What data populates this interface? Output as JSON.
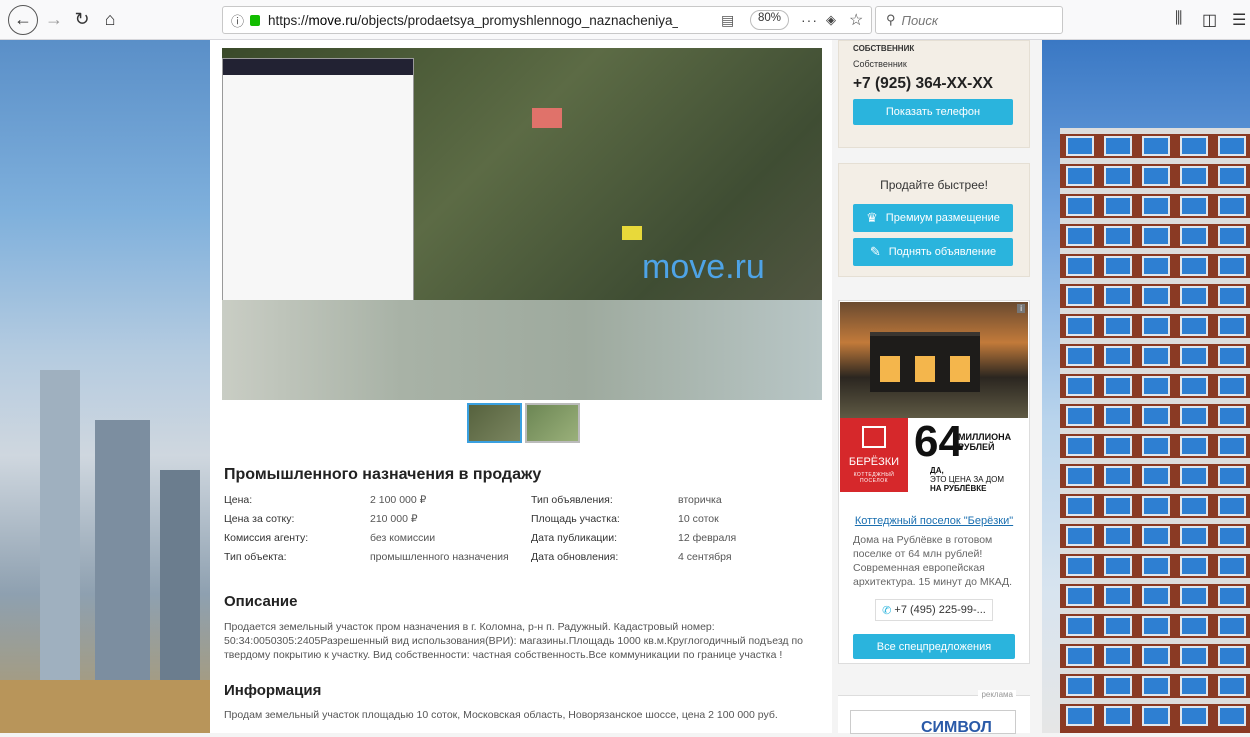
{
  "browser": {
    "url_prefix": "https://",
    "url_host": "move.ru",
    "url_path": "/objects/prodaetsya_promyshlennogo_naznacheniya_ploschad",
    "zoom": "80%",
    "search_placeholder": "Поиск"
  },
  "listing": {
    "watermark": "move.ru",
    "title": "Промышленного назначения в продажу",
    "props": [
      {
        "k1": "Цена:",
        "v1": "2 100 000 ₽",
        "k2": "Тип объявления:",
        "v2": "вторичка"
      },
      {
        "k1": "Цена за сотку:",
        "v1": "210 000 ₽",
        "k2": "Площадь участка:",
        "v2": "10 соток"
      },
      {
        "k1": "Комиссия агенту:",
        "v1": "без комиссии",
        "k2": "Дата публикации:",
        "v2": "12 февраля"
      },
      {
        "k1": "Тип объекта:",
        "v1": "промышленного назначения",
        "k2": "Дата обновления:",
        "v2": "4 сентября"
      }
    ],
    "description_heading": "Описание",
    "description": "Продается земельный участок пром назначения в г. Коломна, р-н п. Радужный. Кадастровый номер: 50:34:0050305:2405Разрешенный вид использования(ВРИ): магазины.Площадь 1000 кв.м.Круглогодичный подъезд по твердому покрытию к участку. Вид собственности: частная собственность.Все коммуникации по границе участка !",
    "info_heading": "Информация",
    "info": "Продам земельный участок площадью 10 соток, Московская область, Новорязанское шоссе, цена 2 100 000 руб."
  },
  "sidebar": {
    "owner_cut": "СОБСТВЕННИК",
    "owner_role": "Собственник",
    "phone": "+7 (925) 364-XX-XX",
    "show_phone": "Показать телефон",
    "sell_title": "Продайте быстрее!",
    "premium": "Премиум размещение",
    "raise": "Поднять объявление"
  },
  "ad": {
    "brand": "БЕРЁЗКИ",
    "brand_sub": "КОТТЕДЖНЫЙ ПОСЕЛОК",
    "big_number": "64",
    "million": "МИЛЛИОНА РУБЛЕЙ",
    "tagline_1": "ДА,",
    "tagline_2": "ЭТО ЦЕНА ЗА ДОМ",
    "tagline_3": "НА РУБЛЁВКЕ",
    "link": "Коттеджный поселок \"Берёзки\"",
    "text": "Дома на Рублёвке в готовом поселке от 64 млн рублей! Современная европейская архитектура. 15 минут до МКАД.",
    "phone": "+7 (495) 225-99-...",
    "offers": "Все спецпредложения",
    "reklama_label": "реклама",
    "reklama_brand": "СИМВОЛ"
  }
}
